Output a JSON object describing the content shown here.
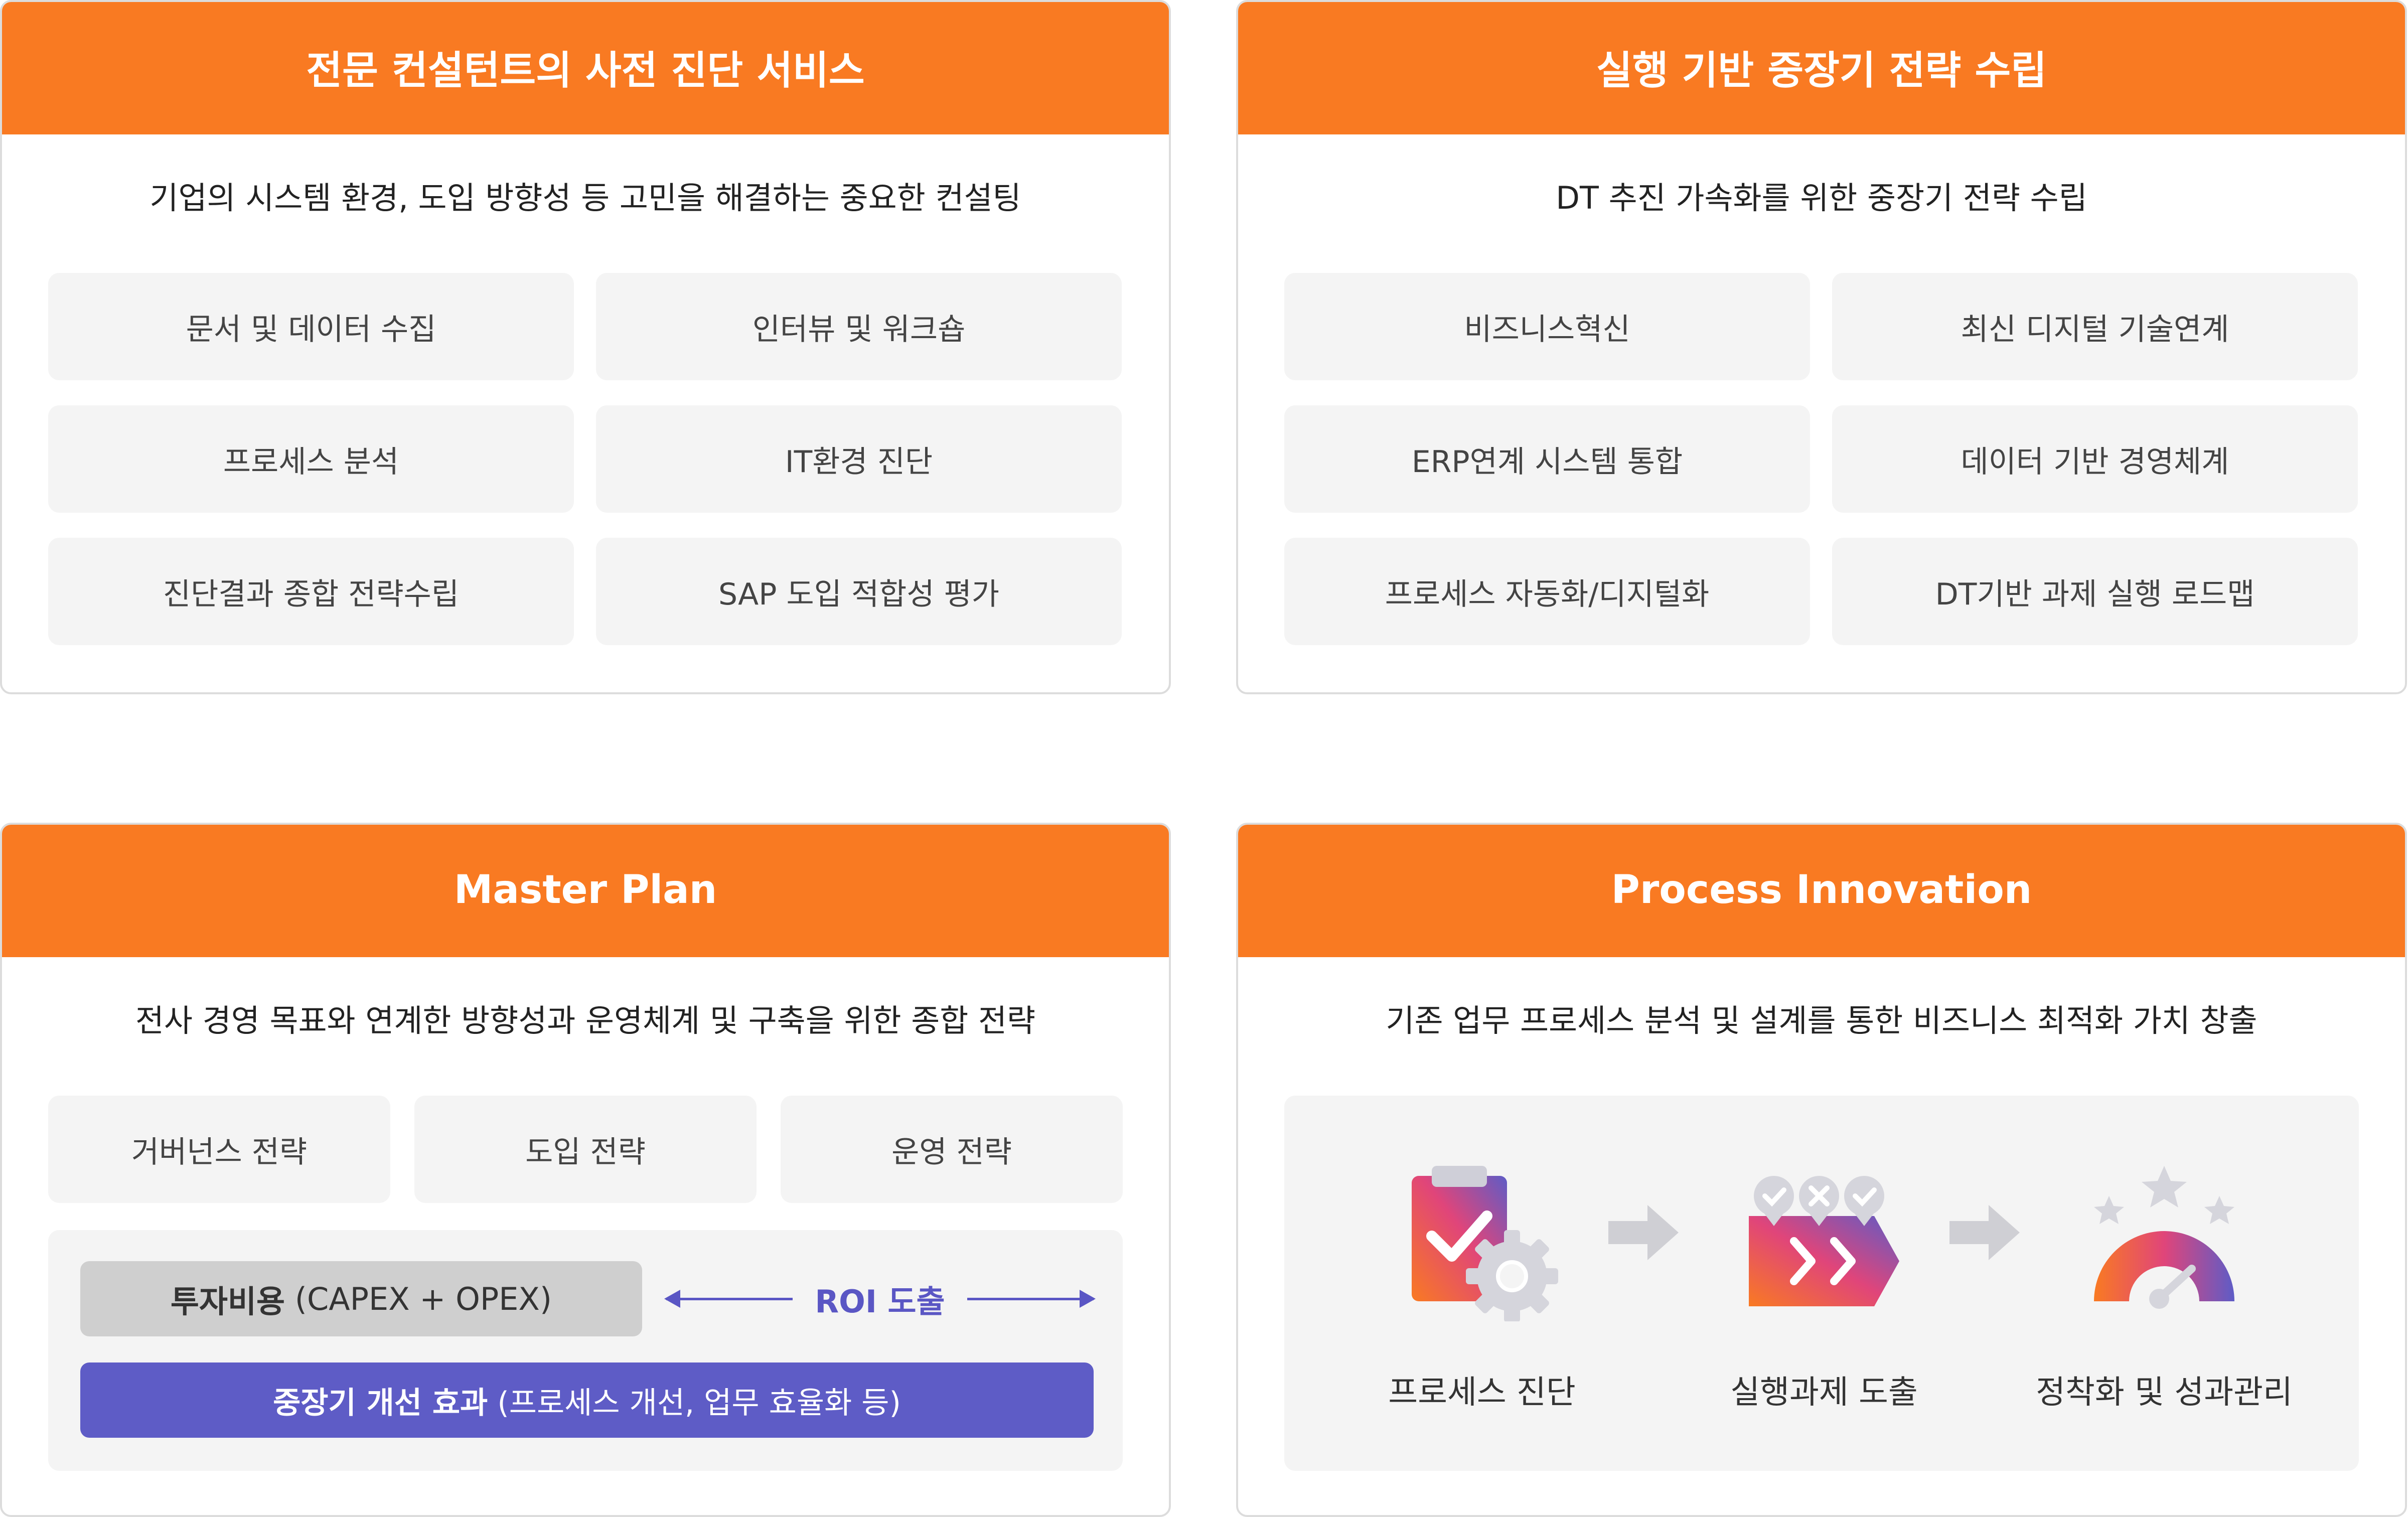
{
  "cards": {
    "consult": {
      "title": "전문 컨설턴트의 사전 진단 서비스",
      "subtitle": "기업의 시스템 환경, 도입 방향성 등 고민을 해결하는 중요한 컨설팅",
      "items": [
        "문서 및 데이터 수집",
        "인터뷰 및 워크숍",
        "프로세스 분석",
        "IT환경 진단",
        "진단결과 종합 전략수립",
        "SAP 도입 적합성 평가"
      ]
    },
    "strategy": {
      "title": "실행 기반 중장기 전략 수립",
      "subtitle": "DT 추진 가속화를 위한 중장기 전략 수립",
      "items": [
        "비즈니스혁신",
        "최신 디지털 기술연계",
        "ERP연계 시스템 통합",
        "데이터 기반 경영체계",
        "프로세스 자동화/디지털화",
        "DT기반 과제 실행 로드맵"
      ]
    },
    "master": {
      "title": "Master Plan",
      "subtitle": "전사 경영 목표와 연계한 방향성과 운영체계 및 구축을 위한 종합 전략",
      "items": [
        "거버넌스 전략",
        "도입 전략",
        "운영 전략"
      ],
      "invest_bold": "투자비용",
      "invest_rest": " (CAPEX + OPEX)",
      "roi_label": "ROI 도출",
      "effect_bold": "중장기 개선 효과",
      "effect_rest": " (프로세스 개선, 업무 효율화 등)"
    },
    "process": {
      "title": "Process Innovation",
      "subtitle": "기존 업무 프로세스 분석 및 설계를 통한 비즈니스 최적화 가치 창출",
      "steps": [
        {
          "label": "프로세스 진단",
          "icon": "clipboard-gear-icon"
        },
        {
          "label": "실행과제 도출",
          "icon": "task-chevron-icon"
        },
        {
          "label": "정착화 및 성과관리",
          "icon": "gauge-stars-icon"
        }
      ],
      "arrow_icon": "right-arrow-icon"
    }
  },
  "colors": {
    "header_orange": "#f97a22",
    "accent_purple": "#5e5cc6",
    "cell_gray": "#f4f4f4",
    "invest_gray": "#cfcfcf"
  }
}
